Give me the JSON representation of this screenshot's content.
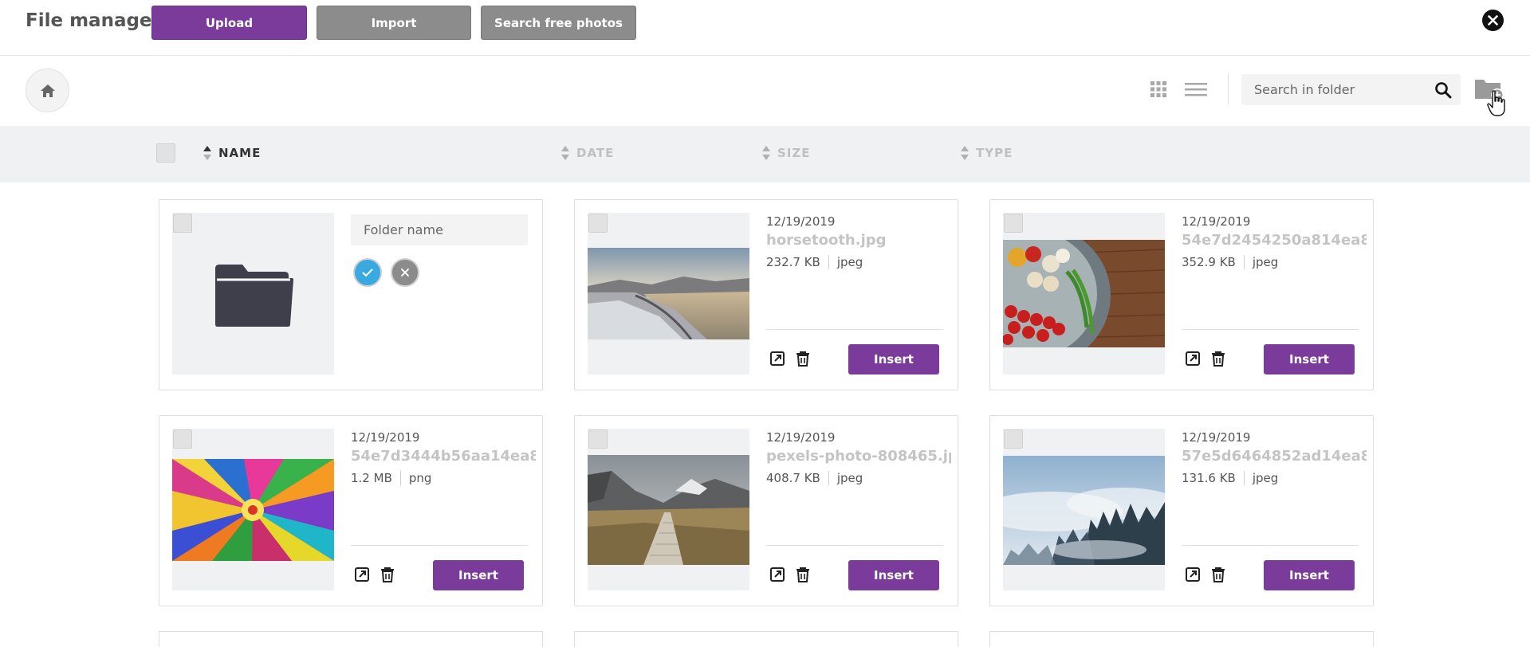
{
  "header": {
    "title": "File manager",
    "buttons": {
      "upload": "Upload",
      "import": "Import",
      "search_photos": "Search free photos"
    }
  },
  "toolbar": {
    "search": {
      "placeholder": "Search in folder",
      "value": ""
    }
  },
  "sort_columns": {
    "name": "NAME",
    "date": "DATE",
    "size": "SIZE",
    "type": "TYPE"
  },
  "new_folder": {
    "placeholder": "Folder name",
    "value": ""
  },
  "insert_label": "Insert",
  "files": [
    {
      "date": "12/19/2019",
      "name": "horsetooth.jpg",
      "size": "232.7 KB",
      "type": "jpeg"
    },
    {
      "date": "12/19/2019",
      "name": "54e7d2454250a814ea8",
      "size": "352.9 KB",
      "type": "jpeg"
    },
    {
      "date": "12/19/2019",
      "name": "54e7d3444b56aa14ea8",
      "size": "1.2 MB",
      "type": "png"
    },
    {
      "date": "12/19/2019",
      "name": "pexels-photo-808465.jp",
      "size": "408.7 KB",
      "type": "jpeg"
    },
    {
      "date": "12/19/2019",
      "name": "57e5d6464852ad14ea8",
      "size": "131.6 KB",
      "type": "jpeg"
    }
  ],
  "colors": {
    "accent": "#7a3b9b",
    "secondary": "#8c8c8c",
    "confirm": "#3aa9e0"
  }
}
